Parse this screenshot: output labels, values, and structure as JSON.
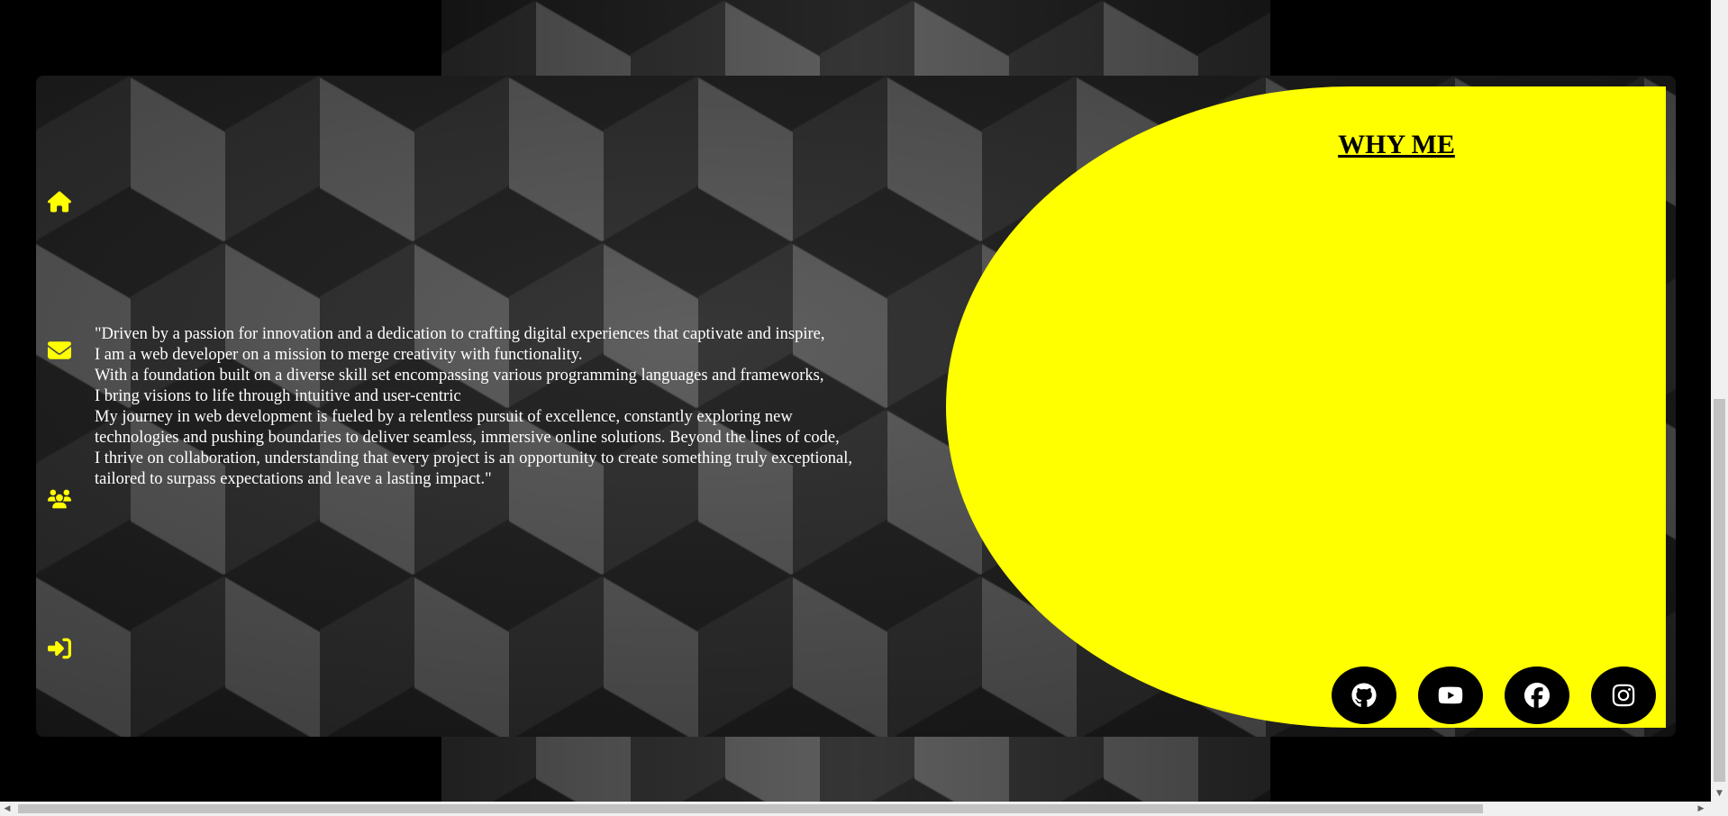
{
  "nav": {
    "items": [
      {
        "icon": "home-icon"
      },
      {
        "icon": "envelope-icon"
      },
      {
        "icon": "users-icon"
      },
      {
        "icon": "sign-in-icon"
      }
    ]
  },
  "quote": {
    "lines": [
      "\"Driven by a passion for innovation and a dedication to crafting digital experiences that captivate and inspire,",
      "I am a web developer on a mission to merge creativity with functionality.",
      "With a foundation built on a diverse skill set encompassing various programming languages and frameworks,",
      "I bring visions to life through intuitive and user-centric",
      "My journey in web development is fueled by a relentless pursuit of excellence, constantly exploring new",
      "technologies and pushing boundaries to deliver seamless, immersive online solutions. Beyond the lines of code,",
      "I thrive on collaboration, understanding that every project is an opportunity to create something truly exceptional,",
      "tailored to surpass expectations and leave a lasting impact.\""
    ]
  },
  "why_me": {
    "title": "WHY ME"
  },
  "social": [
    {
      "icon": "github-icon"
    },
    {
      "icon": "youtube-icon"
    },
    {
      "icon": "facebook-icon"
    },
    {
      "icon": "instagram-icon"
    }
  ],
  "colors": {
    "accent": "#ffff00",
    "background": "#000000",
    "text": "#ffffff"
  }
}
